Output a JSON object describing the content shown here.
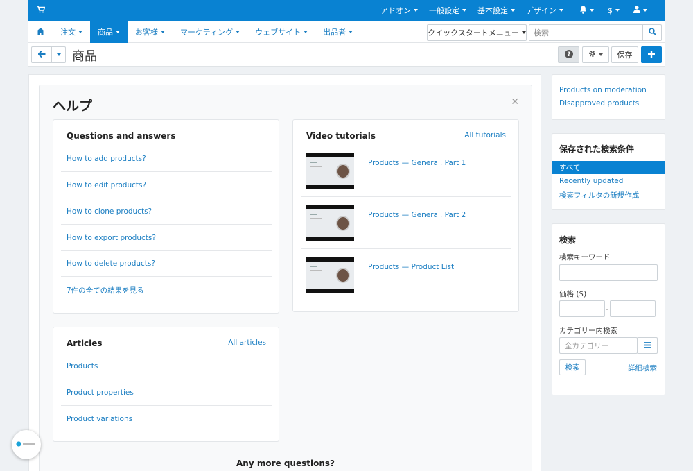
{
  "topbar": {
    "cart_icon": "cart-icon",
    "addons": "アドオン",
    "general_settings": "一般設定",
    "basic_settings": "基本設定",
    "design": "デザイン",
    "bell_icon": "bell-icon",
    "currency": "$",
    "user_icon": "user-icon"
  },
  "menu": {
    "home_icon": "home-icon",
    "items": [
      "注文",
      "商品",
      "お客様",
      "マーケティング",
      "ウェブサイト",
      "出品者"
    ],
    "active": "商品",
    "quick_start": "クイックスタートメニュー",
    "search_placeholder": "検索"
  },
  "toolbar": {
    "page_title": "商品",
    "save": "保存"
  },
  "help": {
    "title": "ヘルプ",
    "qa_title": "Questions and answers",
    "qa_items": [
      "How to add products?",
      "How to edit products?",
      "How to clone products?",
      "How to export products?",
      "How to delete products?",
      "7件の全ての結果を見る"
    ],
    "video_title": "Video tutorials",
    "video_all": "All tutorials",
    "videos": [
      "Products — General. Part 1",
      "Products — General. Part 2",
      "Products — Product List"
    ],
    "articles_title": "Articles",
    "articles_all": "All articles",
    "articles": [
      "Products",
      "Product properties",
      "Product variations"
    ],
    "more_questions": "Any more questions?"
  },
  "sidebar": {
    "moderation": "Products on moderation",
    "disapproved": "Disapproved products",
    "saved_title": "保存された検索条件",
    "saved_items": [
      "すべて",
      "Recently updated",
      "検索フィルタの新規作成"
    ],
    "search_title": "検索",
    "keyword_label": "検索キーワード",
    "price_label": "価格 ($)",
    "price_sep": "-",
    "category_label": "カテゴリー内検索",
    "category_placeholder": "全カテゴリー",
    "search_button": "検索",
    "advanced": "詳細検索"
  },
  "colors": {
    "accent": "#0982d2",
    "link": "#1b7ec2"
  }
}
